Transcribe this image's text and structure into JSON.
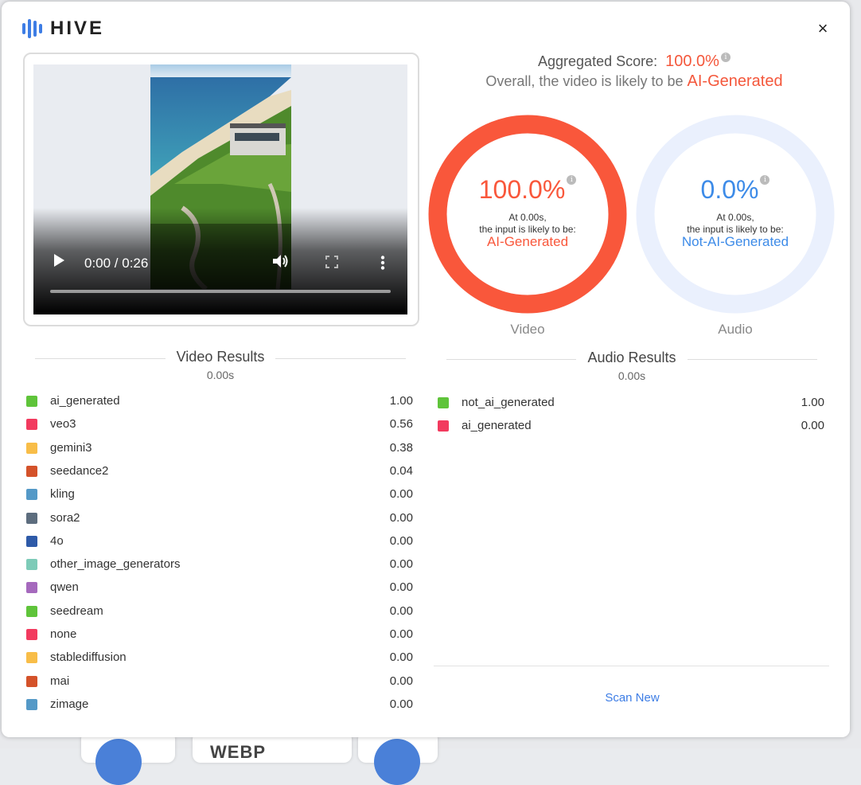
{
  "app": {
    "logo_text": "HIVE",
    "close_label": "×"
  },
  "player": {
    "time": "0:00 / 0:26"
  },
  "aggregate": {
    "label": "Aggregated Score:",
    "score": "100.0%",
    "info": "i",
    "overall_text": "Overall, the video is likely to be",
    "verdict": "AI-Generated"
  },
  "video_ring": {
    "pct": "100.0%",
    "value": 1.0,
    "at_time": "At 0.00s,",
    "likely": "the input is likely to be:",
    "verdict": "AI-Generated",
    "label": "Video",
    "color": "#f9573b"
  },
  "audio_ring": {
    "pct": "0.0%",
    "value": 0.0,
    "at_time": "At 0.00s,",
    "likely": "the input is likely to be:",
    "verdict": "Not-AI-Generated",
    "label": "Audio",
    "color": "#3d8be8"
  },
  "video_results": {
    "title": "Video Results",
    "time": "0.00s",
    "items": [
      {
        "label": "ai_generated",
        "value": "1.00",
        "color": "#5fc43a"
      },
      {
        "label": "veo3",
        "value": "0.56",
        "color": "#f23a5e"
      },
      {
        "label": "gemini3",
        "value": "0.38",
        "color": "#f8bd48"
      },
      {
        "label": "seedance2",
        "value": "0.04",
        "color": "#d4522a"
      },
      {
        "label": "kling",
        "value": "0.00",
        "color": "#5499c7"
      },
      {
        "label": "sora2",
        "value": "0.00",
        "color": "#5d6d7e"
      },
      {
        "label": "4o",
        "value": "0.00",
        "color": "#2e5aa8"
      },
      {
        "label": "other_image_generators",
        "value": "0.00",
        "color": "#7dcbb8"
      },
      {
        "label": "qwen",
        "value": "0.00",
        "color": "#a569bd"
      },
      {
        "label": "seedream",
        "value": "0.00",
        "color": "#5fc43a"
      },
      {
        "label": "none",
        "value": "0.00",
        "color": "#f23a5e"
      },
      {
        "label": "stablediffusion",
        "value": "0.00",
        "color": "#f8bd48"
      },
      {
        "label": "mai",
        "value": "0.00",
        "color": "#d4522a"
      },
      {
        "label": "zimage",
        "value": "0.00",
        "color": "#5499c7"
      }
    ]
  },
  "audio_results": {
    "title": "Audio Results",
    "time": "0.00s",
    "items": [
      {
        "label": "not_ai_generated",
        "value": "1.00",
        "color": "#5fc43a"
      },
      {
        "label": "ai_generated",
        "value": "0.00",
        "color": "#f23a5e"
      }
    ]
  },
  "scan_new_label": "Scan New",
  "background_peek": {
    "label": "WEBP"
  }
}
